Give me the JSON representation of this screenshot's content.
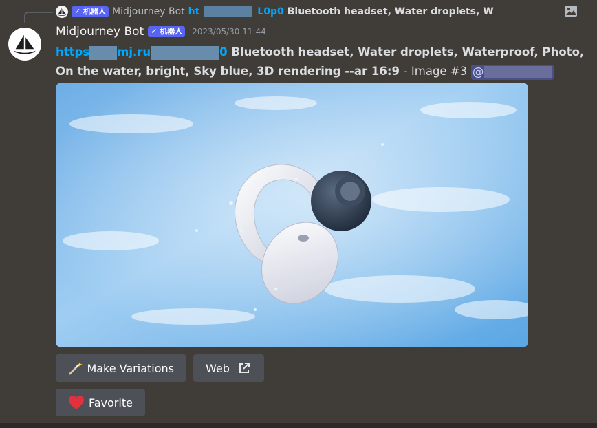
{
  "reply": {
    "author": "Midjourney Bot",
    "bot_tag": "✓ 机器人",
    "link_prefix": "ht",
    "link_suffix": "L0p0",
    "text": "Bluetooth headset, Water droplets, W"
  },
  "message": {
    "author": "Midjourney Bot",
    "bot_tag": "✓ 机器人",
    "timestamp": "2023/05/30 11:44",
    "link_prefix": "https",
    "link_mid": "mj.ru",
    "link_suffix": "0",
    "prompt": "Bluetooth headset, Water droplets, Waterproof, Photo, On the water, bright, Sky blue, 3D rendering --ar 16:9",
    "image_label": "- Image #3",
    "mention_prefix": "@"
  },
  "buttons": {
    "vary": "Make Variations",
    "web": "Web",
    "favorite": "Favorite"
  },
  "colors": {
    "background": "#403c38",
    "link": "#00a8fc",
    "bot_tag": "#5865f2",
    "button": "#4e5058"
  }
}
